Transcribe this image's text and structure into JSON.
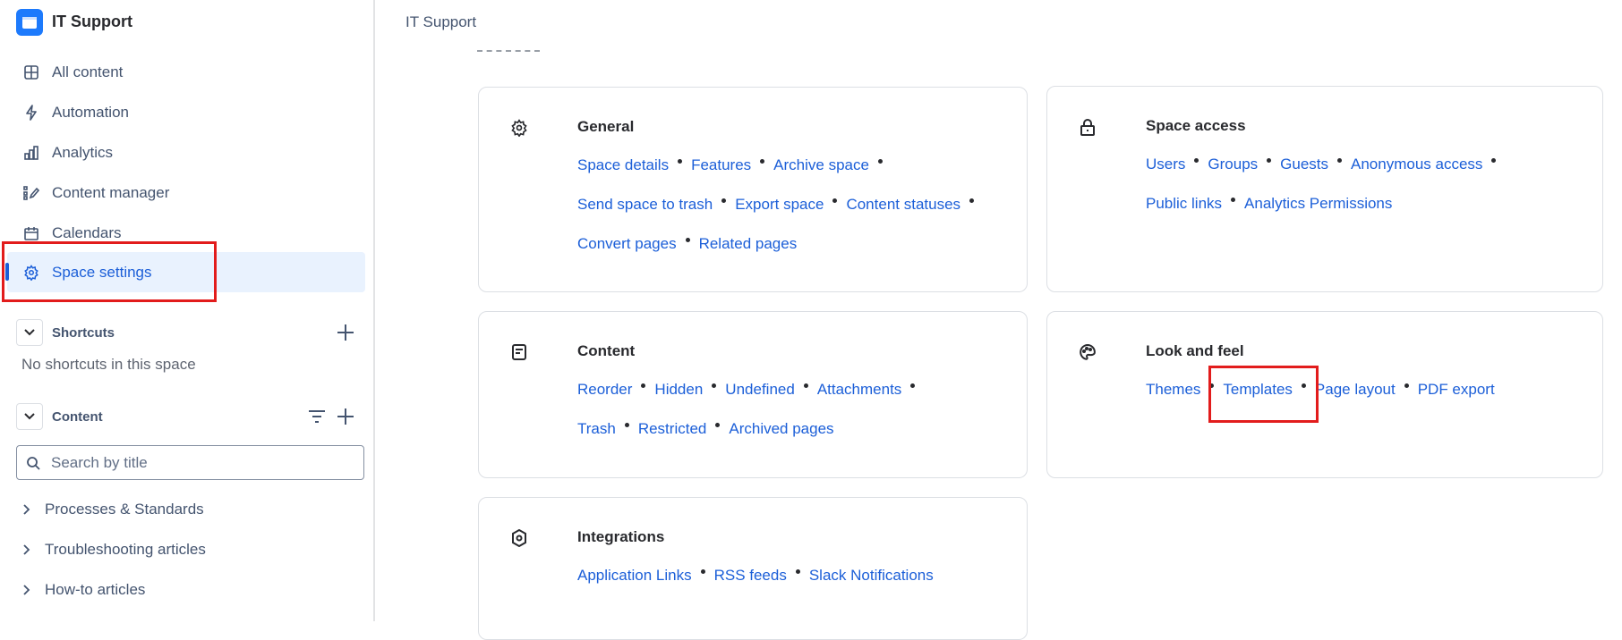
{
  "sidebar": {
    "space_name": "IT Support",
    "nav": [
      {
        "label": "All content",
        "icon": "grid-icon"
      },
      {
        "label": "Automation",
        "icon": "lightning-icon"
      },
      {
        "label": "Analytics",
        "icon": "bar-chart-icon"
      },
      {
        "label": "Content manager",
        "icon": "content-manager-icon"
      },
      {
        "label": "Calendars",
        "icon": "calendar-icon"
      },
      {
        "label": "Space settings",
        "icon": "gear-icon",
        "active": true
      }
    ],
    "shortcuts": {
      "label": "Shortcuts",
      "empty_text": "No shortcuts in this space"
    },
    "content": {
      "label": "Content",
      "search_placeholder": "Search by title",
      "tree": [
        "Processes & Standards",
        "Troubleshooting articles",
        "How-to articles"
      ]
    }
  },
  "main": {
    "breadcrumb": "IT Support",
    "cards": [
      {
        "title": "General",
        "icon": "gear-icon",
        "rows": [
          [
            "Space details",
            "Features",
            "Archive space"
          ],
          [
            "Send space to trash",
            "Export space",
            "Content statuses"
          ],
          [
            "Convert pages",
            "Related pages"
          ]
        ]
      },
      {
        "title": "Space access",
        "icon": "lock-icon",
        "rows": [
          [
            "Users",
            "Groups",
            "Guests",
            "Anonymous access"
          ],
          [
            "Public links",
            "Analytics Permissions"
          ]
        ]
      },
      {
        "title": "Content",
        "icon": "page-icon",
        "rows": [
          [
            "Reorder",
            "Hidden",
            "Undefined",
            "Attachments"
          ],
          [
            "Trash",
            "Restricted",
            "Archived pages"
          ]
        ]
      },
      {
        "title": "Look and feel",
        "icon": "palette-icon",
        "rows": [
          [
            "Themes",
            "Templates",
            "Page layout",
            "PDF export"
          ]
        ]
      },
      {
        "title": "Integrations",
        "icon": "hexagon-icon",
        "rows": [
          [
            "Application Links",
            "RSS feeds",
            "Slack Notifications"
          ]
        ]
      }
    ]
  },
  "colors": {
    "link": "#1c5fd8",
    "accent": "#1d7afc",
    "highlight": "#e21c1c",
    "active_bg": "#e9f2fe"
  }
}
